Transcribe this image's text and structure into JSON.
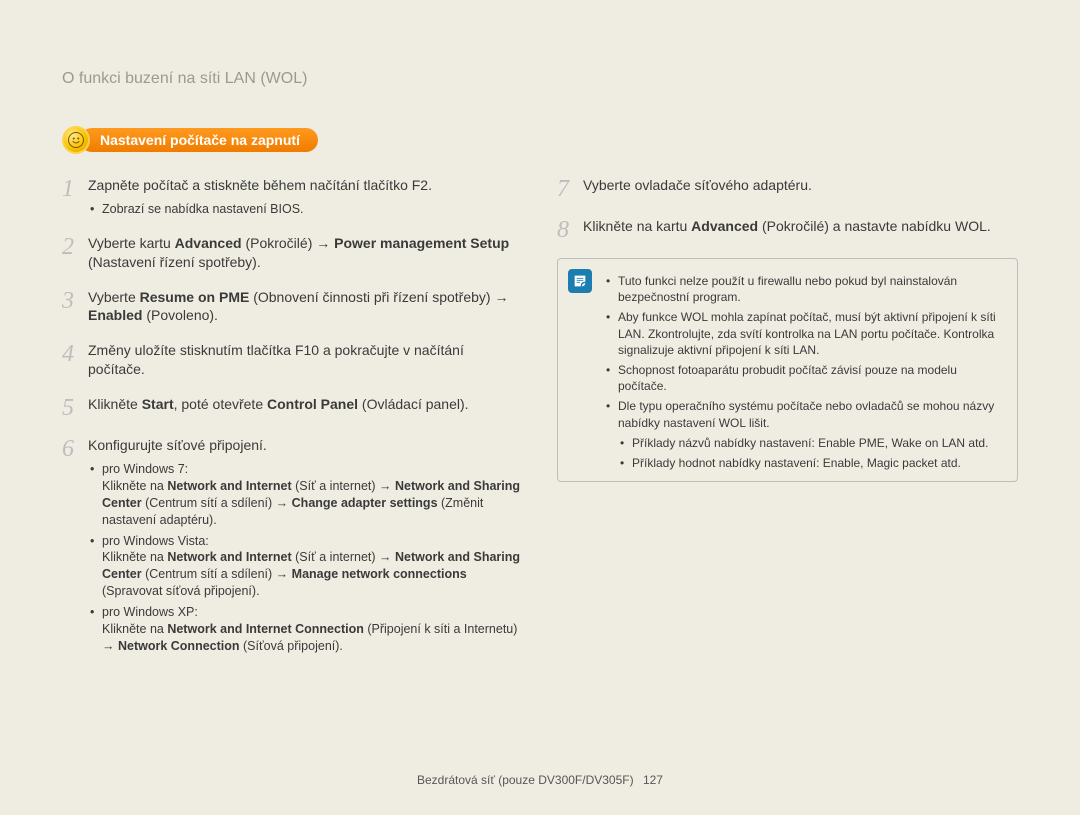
{
  "title": "O funkci buzení na síti LAN (WOL)",
  "badge": {
    "label": "Nastavení počítače na zapnutí"
  },
  "left": {
    "steps": [
      {
        "num": "1",
        "html": "Zapněte počítač a stiskněte během načítání tlačítko F2.",
        "sub": [
          {
            "html": "Zobrazí se nabídka nastavení BIOS."
          }
        ]
      },
      {
        "num": "2",
        "html": "Vyberte kartu <b>Advanced</b> (Pokročilé) <span class='arrow'>→</span> <b>Power management Setup</b> (Nastavení řízení spotřeby)."
      },
      {
        "num": "3",
        "html": "Vyberte <b>Resume on PME</b> (Obnovení činnosti při řízení spotřeby) <span class='arrow'>→</span> <b>Enabled</b> (Povoleno)."
      },
      {
        "num": "4",
        "html": "Změny uložíte stisknutím tlačítka F10 a pokračujte v načítání počítače."
      },
      {
        "num": "5",
        "html": "Klikněte <b>Start</b>, poté otevřete <b>Control Panel</b> (Ovládací panel)."
      },
      {
        "num": "6",
        "html": "Konfigurujte síťové připojení.",
        "sub": [
          {
            "html": "pro Windows 7:<br>Klikněte na <b>Network and Internet</b> (Síť a internet) <span class='arrow'>→</span> <b>Network and Sharing Center</b> (Centrum sítí a sdílení) <span class='arrow'>→</span> <b>Change adapter settings</b> (Změnit nastavení adaptéru)."
          },
          {
            "html": "pro Windows Vista:<br>Klikněte na <b>Network and Internet</b> (Síť a internet) <span class='arrow'>→</span> <b>Network and Sharing Center</b> (Centrum sítí a sdílení) <span class='arrow'>→</span> <b>Manage network connections</b> (Spravovat síťová připojení)."
          },
          {
            "html": "pro Windows XP:<br>Klikněte na <b>Network and Internet Connection</b> (Připojení k síti a Internetu) <span class='arrow'>→</span> <b>Network Connection</b> (Síťová připojení)."
          }
        ]
      }
    ]
  },
  "right": {
    "steps": [
      {
        "num": "7",
        "html": "Vyberte ovladače síťového adaptéru."
      },
      {
        "num": "8",
        "html": "Klikněte na kartu <b>Advanced</b> (Pokročilé) a nastavte nabídku WOL."
      }
    ],
    "note": {
      "items": [
        {
          "html": "Tuto funkci nelze použít u firewallu nebo pokud byl nainstalován bezpečnostní program."
        },
        {
          "html": "Aby funkce WOL mohla zapínat počítač, musí být aktivní připojení k síti LAN. Zkontrolujte, zda svítí kontrolka na LAN portu počítače. Kontrolka signalizuje aktivní připojení k síti LAN."
        },
        {
          "html": "Schopnost fotoaparátu probudit počítač závisí pouze na modelu počítače."
        },
        {
          "html": "Dle typu operačního systému počítače nebo ovladačů se mohou názvy nabídky nastavení WOL lišit.",
          "dash": [
            {
              "html": "Příklady názvů nabídky nastavení: Enable PME, Wake on LAN atd."
            },
            {
              "html": "Příklady hodnot nabídky nastavení: Enable, Magic packet atd."
            }
          ]
        }
      ]
    }
  },
  "footer": {
    "text": "Bezdrátová síť (pouze DV300F/DV305F)",
    "page": "127"
  }
}
